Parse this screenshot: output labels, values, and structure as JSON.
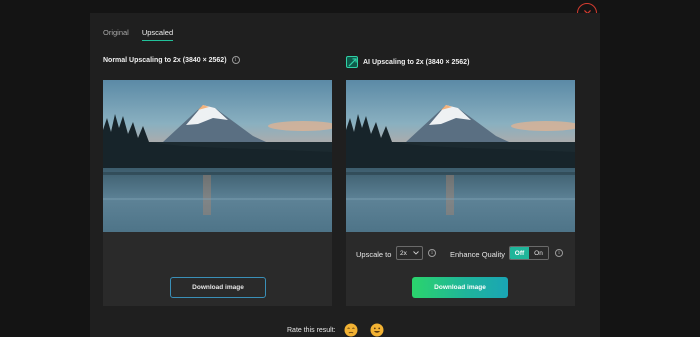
{
  "tabs": [
    {
      "label": "Original",
      "active": false
    },
    {
      "label": "Upscaled",
      "active": true
    }
  ],
  "left_panel": {
    "title": "Normal Upscaling to 2x (3840 × 2562)",
    "download_label": "Download image"
  },
  "right_panel": {
    "title": "AI Upscaling to 2x (3840 × 2562)",
    "upscale_label": "Upscale to",
    "upscale_value": "2x",
    "enhance_label": "Enhance Quality",
    "toggle_off": "Off",
    "toggle_on": "On",
    "download_label": "Download image"
  },
  "rating": {
    "prompt": "Rate this result:",
    "options": [
      "sad-face-icon",
      "happy-face-icon"
    ]
  },
  "colors": {
    "accent": "#21c19a",
    "close": "#d23b2f",
    "emoji": "#f2b233"
  },
  "icons": {
    "close": "close-icon",
    "info": "info-icon",
    "ai": "ai-upscale-icon",
    "dropdown": "chevron-down-icon"
  }
}
